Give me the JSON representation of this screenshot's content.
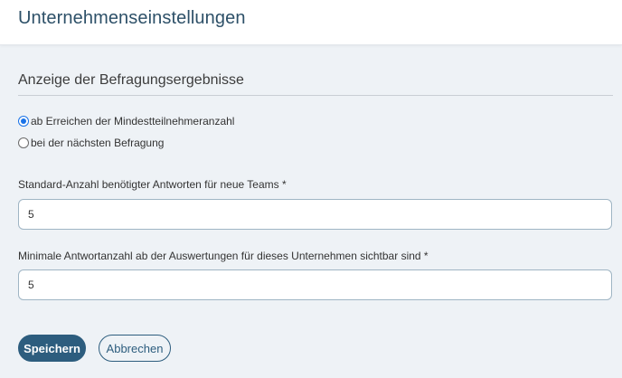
{
  "header": {
    "title": "Unternehmenseinstellungen"
  },
  "results_display": {
    "title": "Anzeige der Befragungsergebnisse",
    "options": [
      {
        "label": "ab Erreichen der Mindestteilnehmeranzahl",
        "selected": true
      },
      {
        "label": "bei der nächsten Befragung",
        "selected": false
      }
    ]
  },
  "fields": {
    "default_answers": {
      "label": "Standard-Anzahl benötigter Antworten für neue Teams *",
      "value": "5"
    },
    "min_answers": {
      "label": "Minimale Antwortanzahl ab der Auswertungen für dieses Unternehmen sichtbar sind *",
      "value": "5"
    }
  },
  "actions": {
    "save_label": "Speichern",
    "cancel_label": "Abbrechen"
  },
  "colors": {
    "primary": "#2d5d7e",
    "header_title": "#2d5068",
    "background": "#eef2f6"
  }
}
